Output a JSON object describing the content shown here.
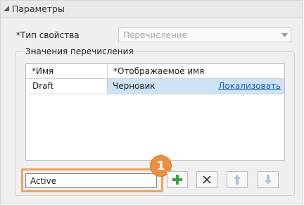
{
  "panel": {
    "title": "Параметры"
  },
  "property_type": {
    "label": "*Тип свойства",
    "value": "Перечисление"
  },
  "enum_group": {
    "title": "Значения перечисления",
    "columns": [
      "*Имя",
      "*Отображаемое имя"
    ],
    "rows": [
      {
        "name": "Draft",
        "display_name": "Черновик",
        "link": "Локализовать"
      }
    ]
  },
  "new_value_input": {
    "value": "Active"
  },
  "callout": {
    "number": "1"
  },
  "toolbar": {
    "add_icon": "plus-icon",
    "delete_icon": "x-icon",
    "move_up_icon": "arrow-up-icon",
    "move_down_icon": "arrow-down-icon"
  },
  "colors": {
    "callout": "#ee8e3e",
    "selection": "#cde3f6",
    "link": "#1a5fb4",
    "add": "#3aa535"
  }
}
